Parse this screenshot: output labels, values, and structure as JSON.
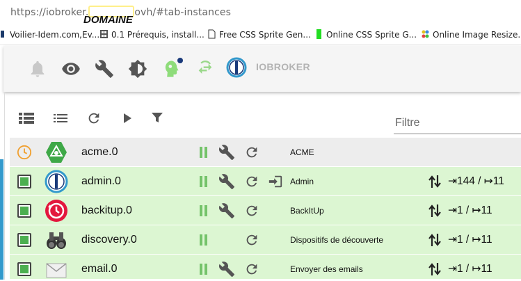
{
  "browser": {
    "url_prefix": "https://iobroker.",
    "url_suffix": "ovh/#tab-instances",
    "annotation": "DOMAINE"
  },
  "bookmarks": [
    {
      "label": "Voilier-Idem.com,Ev...",
      "icon": "globe-icon"
    },
    {
      "label": "0.1 Prérequis, install...",
      "icon": "page-icon"
    },
    {
      "label": "Free CSS Sprite Gen...",
      "icon": "document-icon"
    },
    {
      "label": "Online CSS Sprite G...",
      "icon": "green-bar-icon"
    },
    {
      "label": "Online Image Resize...",
      "icon": "colorful-icon"
    }
  ],
  "appbar": {
    "brand": "IOBROKER",
    "tools": [
      "bell-icon",
      "eye-icon",
      "wrench-icon",
      "brightness-icon",
      "expert-head-icon",
      "swap-icon"
    ]
  },
  "toolbar": {
    "filter_placeholder": "Filtre"
  },
  "instances": [
    {
      "name": "acme.0",
      "title": "ACME",
      "state": "scheduled",
      "events": "",
      "has_settings": true,
      "has_link": false
    },
    {
      "name": "admin.0",
      "title": "Admin",
      "state": "running",
      "events": "⇥144 / ↦11",
      "has_settings": true,
      "has_link": true
    },
    {
      "name": "backitup.0",
      "title": "BackItUp",
      "state": "running",
      "events": "⇥1 / ↦11",
      "has_settings": true,
      "has_link": false
    },
    {
      "name": "discovery.0",
      "title": "Dispositifs de découverte",
      "state": "running",
      "events": "⇥1 / ↦11",
      "has_settings": false,
      "has_link": false
    },
    {
      "name": "email.0",
      "title": "Envoyer des emails",
      "state": "running",
      "events": "⇥1 / ↦11",
      "has_settings": true,
      "has_link": false
    }
  ],
  "colors": {
    "running_row": "#dcf6d2",
    "scheduled_row": "#ededed",
    "accent": "#3399cc",
    "play_green": "#74c36a"
  }
}
